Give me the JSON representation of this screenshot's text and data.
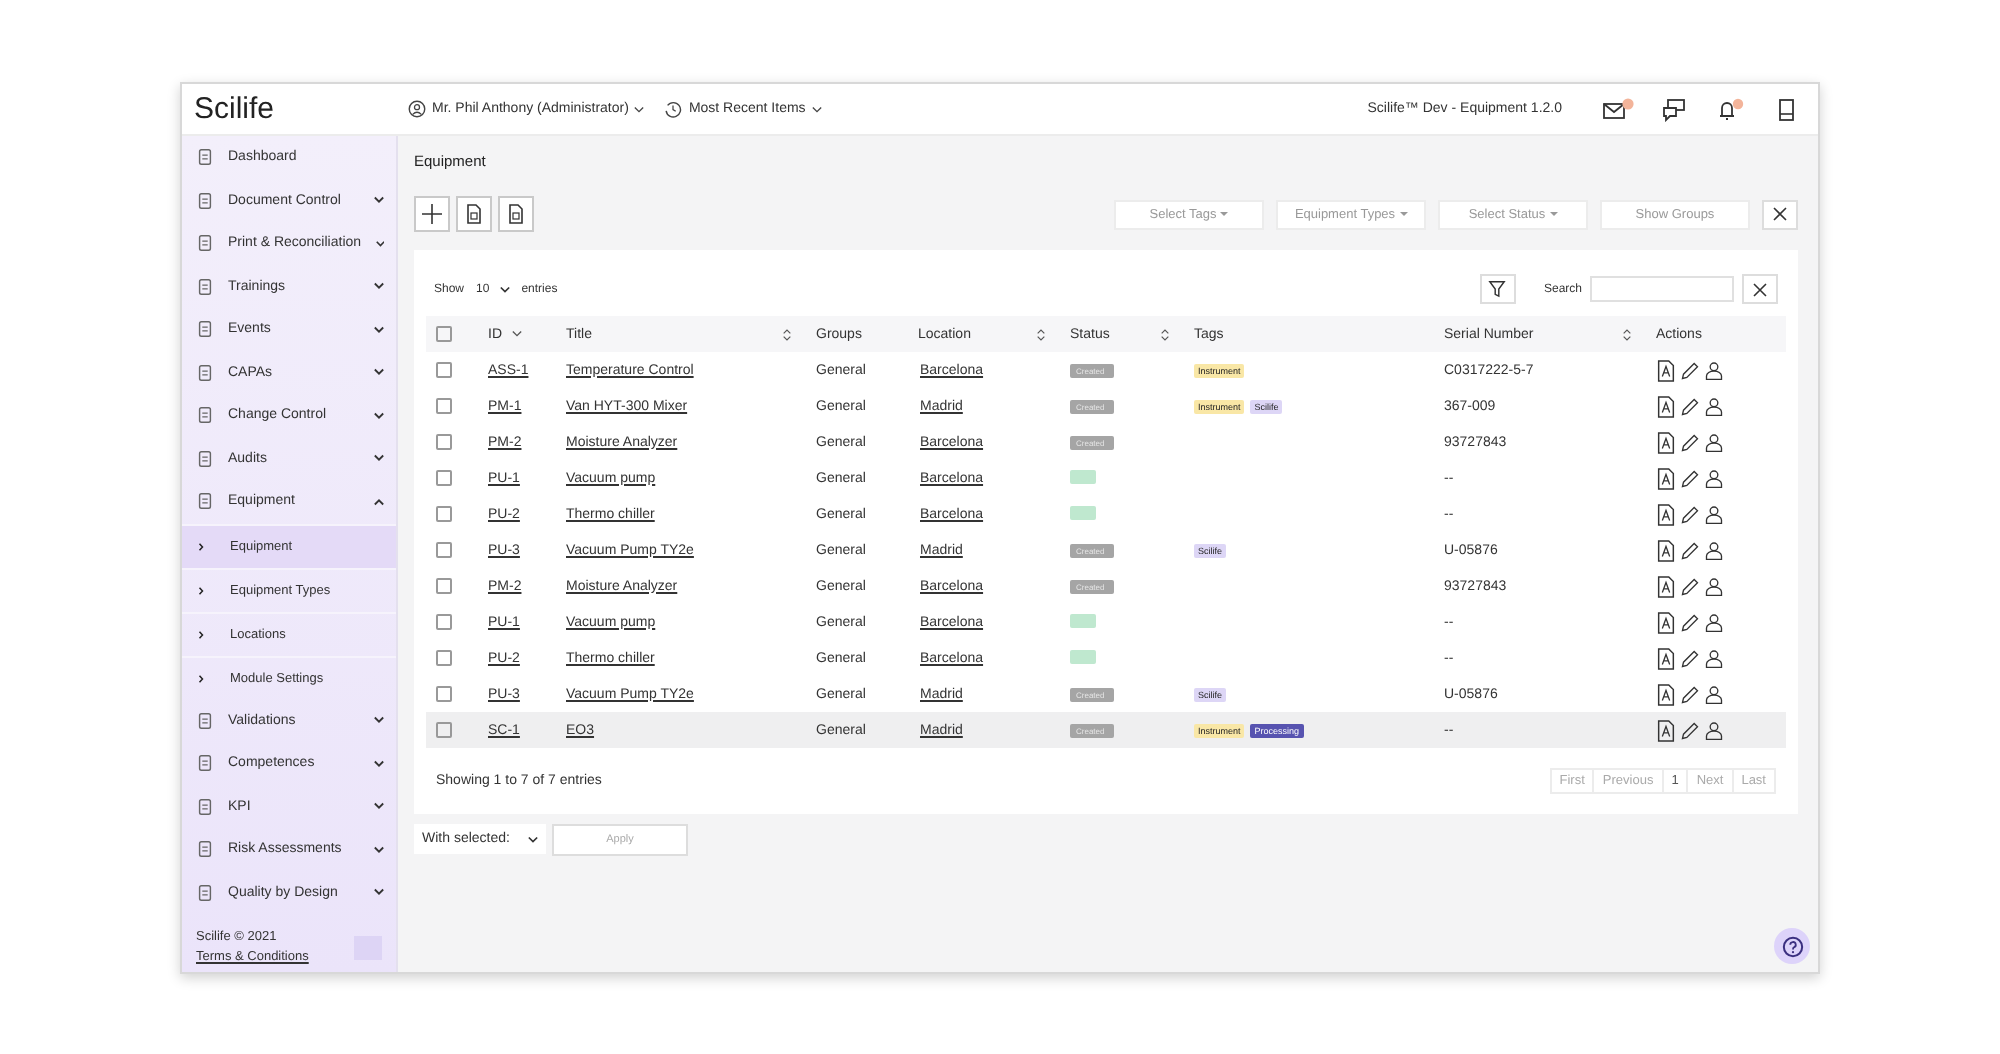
{
  "header": {
    "logo": "Scilife",
    "user_menu": "Mr. Phil Anthony (Administrator)",
    "recent_menu": "Most Recent Items",
    "environment": "Scilife™ Dev - Equipment 1.2.0"
  },
  "sidebar": {
    "items": [
      {
        "label": "Dashboard"
      },
      {
        "label": "Document Control",
        "expanded": false
      },
      {
        "label": "Print & Reconciliation",
        "expanded": false
      },
      {
        "label": "Trainings",
        "expanded": false
      },
      {
        "label": "Events",
        "expanded": false
      },
      {
        "label": "CAPAs",
        "expanded": false
      },
      {
        "label": "Change Control",
        "expanded": false
      },
      {
        "label": "Audits",
        "expanded": false
      },
      {
        "label": "Equipment",
        "expanded": true,
        "children": [
          {
            "label": "Equipment",
            "selected": true
          },
          {
            "label": "Equipment Types",
            "selected": false
          },
          {
            "label": "Locations",
            "selected": false
          },
          {
            "label": "Module Settings",
            "selected": false
          }
        ]
      },
      {
        "label": "Validations",
        "expanded": false
      },
      {
        "label": "Competences",
        "expanded": false
      },
      {
        "label": "KPI",
        "expanded": false
      },
      {
        "label": "Risk Assessments",
        "expanded": false
      },
      {
        "label": "Quality by Design",
        "expanded": false
      }
    ],
    "copyright": "Scilife © 2021",
    "terms": "Terms & Conditions"
  },
  "page_title": "Equipment",
  "filters": [
    {
      "label": "Select Tags",
      "dropdown": true
    },
    {
      "label": "Equipment Types",
      "dropdown": true
    },
    {
      "label": "Select Status",
      "dropdown": true
    },
    {
      "label": "Show Groups",
      "dropdown": false
    }
  ],
  "table": {
    "show_label": "Show",
    "page_size": "10",
    "entries_label": "entries",
    "search_label": "Search",
    "all_checked": false,
    "columns": [
      {
        "label": "ID",
        "kind": "caret"
      },
      {
        "label": "Title",
        "kind": "sortable"
      },
      {
        "label": "Groups",
        "kind": "plain"
      },
      {
        "label": "Location",
        "kind": "sortable"
      },
      {
        "label": "Status",
        "kind": "sortable"
      },
      {
        "label": "Tags",
        "kind": "plain"
      },
      {
        "label": "Serial Number",
        "kind": "sortable"
      },
      {
        "label": "Actions",
        "kind": "plain"
      }
    ],
    "rows": [
      {
        "id": "ASS-1",
        "title": "Temperature Control",
        "group": "General",
        "location": "Barcelona",
        "status": {
          "kind": "grey",
          "label": "Created"
        },
        "tags": [
          {
            "label": "Instrument",
            "color": "#f9e7a6"
          }
        ],
        "serial": "C0317222-5-7",
        "checked": false,
        "selected": false
      },
      {
        "id": "PM-1",
        "title": "Van HYT-300 Mixer",
        "group": "General",
        "location": "Madrid",
        "status": {
          "kind": "grey",
          "label": "Created"
        },
        "tags": [
          {
            "label": "Instrument",
            "color": "#f9e7a6"
          },
          {
            "label": "Scilife",
            "color": "#ddd6f6"
          }
        ],
        "serial": "367-009",
        "checked": false,
        "selected": false
      },
      {
        "id": "PM-2",
        "title": "Moisture Analyzer",
        "group": "General",
        "location": "Barcelona",
        "status": {
          "kind": "grey",
          "label": "Created"
        },
        "tags": [],
        "serial": "93727843",
        "checked": false,
        "selected": false
      },
      {
        "id": "PU-1",
        "title": "Vacuum pump",
        "group": "General",
        "location": "Barcelona",
        "status": {
          "kind": "green"
        },
        "tags": [],
        "serial": "--",
        "checked": false,
        "selected": false
      },
      {
        "id": "PU-2",
        "title": "Thermo chiller",
        "group": "General",
        "location": "Barcelona",
        "status": {
          "kind": "green"
        },
        "tags": [],
        "serial": "--",
        "checked": false,
        "selected": false
      },
      {
        "id": "PU-3",
        "title": "Vacuum Pump TY2e",
        "group": "General",
        "location": "Madrid",
        "status": {
          "kind": "grey",
          "label": "Created"
        },
        "tags": [
          {
            "label": "Scilife",
            "color": "#ddd6f6"
          }
        ],
        "serial": "U-05876",
        "checked": false,
        "selected": false
      },
      {
        "id": "PM-2",
        "title": "Moisture Analyzer",
        "group": "General",
        "location": "Barcelona",
        "status": {
          "kind": "grey",
          "label": "Created"
        },
        "tags": [],
        "serial": "93727843",
        "checked": false,
        "selected": false
      },
      {
        "id": "PU-1",
        "title": "Vacuum pump",
        "group": "General",
        "location": "Barcelona",
        "status": {
          "kind": "green"
        },
        "tags": [],
        "serial": "--",
        "checked": false,
        "selected": false
      },
      {
        "id": "PU-2",
        "title": "Thermo chiller",
        "group": "General",
        "location": "Barcelona",
        "status": {
          "kind": "green"
        },
        "tags": [],
        "serial": "--",
        "checked": false,
        "selected": false
      },
      {
        "id": "PU-3",
        "title": "Vacuum Pump TY2e",
        "group": "General",
        "location": "Madrid",
        "status": {
          "kind": "grey",
          "label": "Created"
        },
        "tags": [
          {
            "label": "Scilife",
            "color": "#ddd6f6"
          }
        ],
        "serial": "U-05876",
        "checked": false,
        "selected": false
      },
      {
        "id": "SC-1",
        "title": "EO3",
        "group": "General",
        "location": "Madrid",
        "status": {
          "kind": "grey",
          "label": "Created"
        },
        "tags": [
          {
            "label": "Instrument",
            "color": "#f9e7a6"
          },
          {
            "label": "Processing",
            "color": "#5753b0"
          }
        ],
        "serial": "--",
        "checked": false,
        "selected": true
      }
    ],
    "info": "Showing 1 to 7 of 7 entries",
    "pagination": [
      {
        "label": "First",
        "selected": false
      },
      {
        "label": "Previous",
        "selected": false
      },
      {
        "label": "1",
        "selected": true
      },
      {
        "label": "Next",
        "selected": false
      },
      {
        "label": "Last",
        "selected": false
      }
    ]
  },
  "bulk": {
    "select": "With selected:",
    "apply": "Apply"
  }
}
